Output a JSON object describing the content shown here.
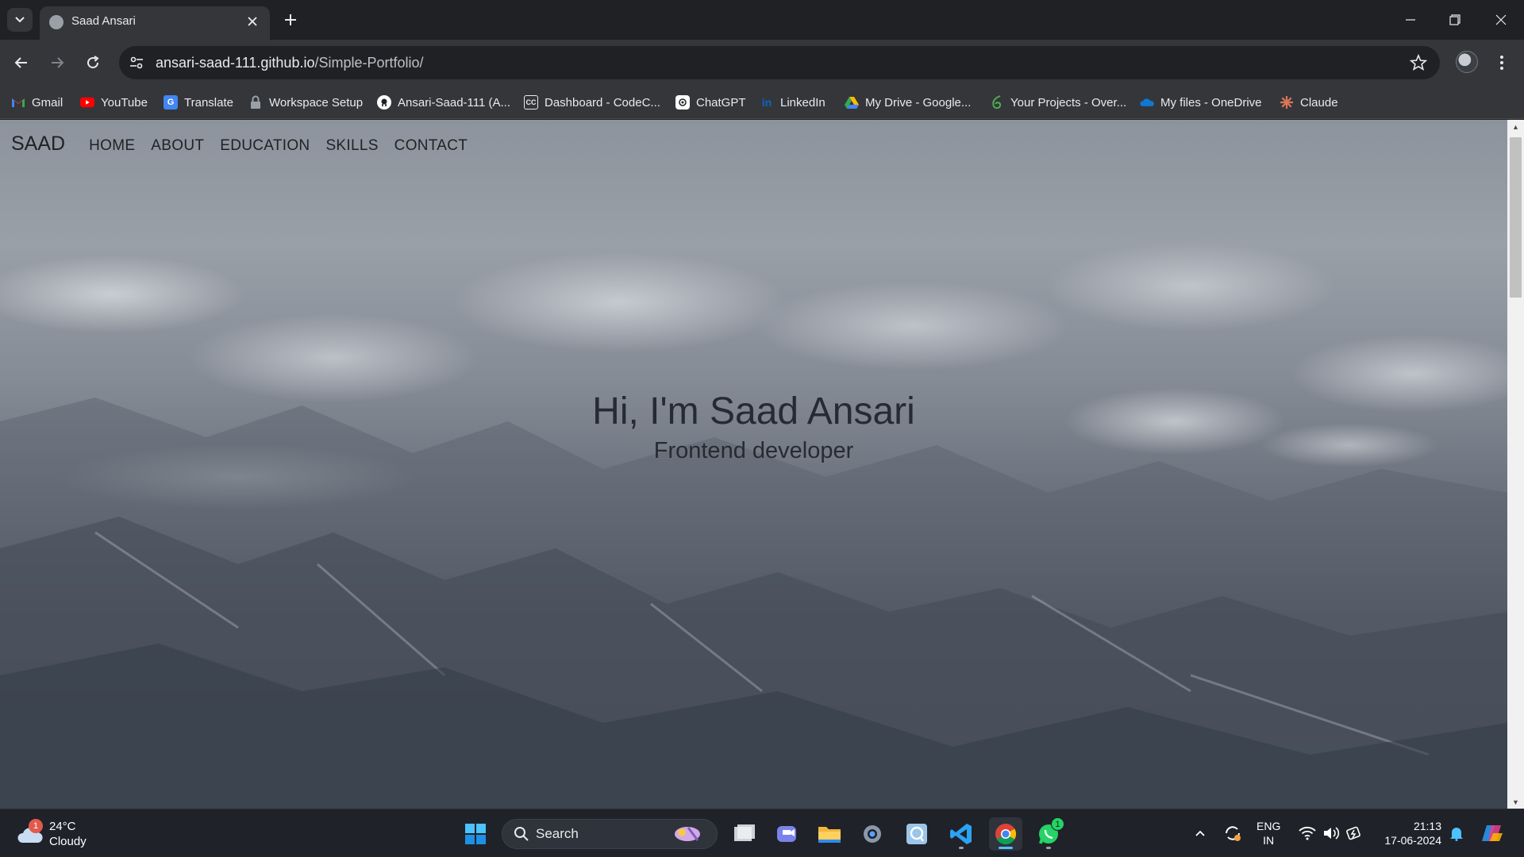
{
  "browser": {
    "tab": {
      "title": "Saad Ansari"
    },
    "url": {
      "host": "ansari-saad-111.github.io",
      "path": "/Simple-Portfolio/"
    },
    "bookmarks": [
      {
        "label": "Gmail",
        "icon": "gmail-icon",
        "color": "#ea4335"
      },
      {
        "label": "YouTube",
        "icon": "youtube-icon",
        "color": "#ff0000"
      },
      {
        "label": "Translate",
        "icon": "translate-icon",
        "color": "#4285f4"
      },
      {
        "label": "Workspace Setup",
        "icon": "lock-icon",
        "color": "#9aa0a6"
      },
      {
        "label": "Ansari-Saad-111 (A...",
        "icon": "github-icon",
        "color": "#ffffff"
      },
      {
        "label": "Dashboard - CodeC...",
        "icon": "codechef-icon",
        "color": "#ffffff"
      },
      {
        "label": "ChatGPT",
        "icon": "chatgpt-icon",
        "color": "#ffffff"
      },
      {
        "label": "LinkedIn",
        "icon": "linkedin-icon",
        "color": "#0a66c2"
      },
      {
        "label": "My Drive - Google...",
        "icon": "drive-icon",
        "color": "#34a853"
      },
      {
        "label": "Your Projects - Over...",
        "icon": "overleaf-icon",
        "color": "#4caf50"
      },
      {
        "label": "My files - OneDrive",
        "icon": "onedrive-icon",
        "color": "#0f78d4"
      },
      {
        "label": "Claude",
        "icon": "claude-icon",
        "color": "#d97757"
      }
    ]
  },
  "site": {
    "brand": "SAAD",
    "nav": [
      "HOME",
      "ABOUT",
      "EDUCATION",
      "SKILLS",
      "CONTACT"
    ],
    "hero": {
      "title": "Hi, I'm Saad Ansari",
      "subtitle": "Frontend developer"
    }
  },
  "taskbar": {
    "weather": {
      "temp": "24°C",
      "condition": "Cloudy",
      "badge": "1"
    },
    "search_label": "Search",
    "whatsapp_badge": "1",
    "language": {
      "line1": "ENG",
      "line2": "IN"
    },
    "clock": {
      "time": "21:13",
      "date": "17-06-2024"
    }
  }
}
